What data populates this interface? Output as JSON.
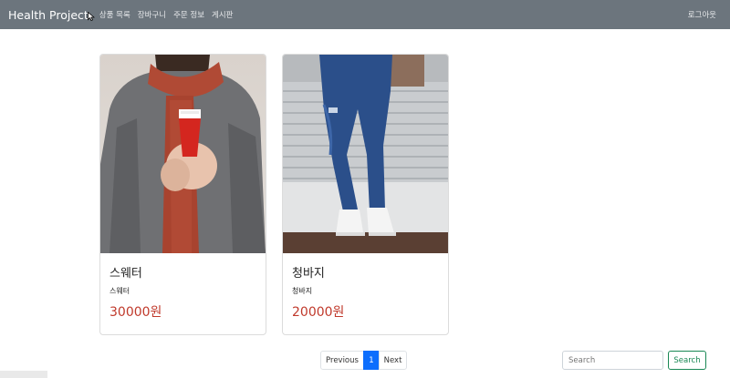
{
  "navbar": {
    "brand": "Health Project",
    "links": [
      "상품 목록",
      "장바구니",
      "주문 정보",
      "게시판"
    ],
    "logout": "로그아웃"
  },
  "products": [
    {
      "title": "스웨터",
      "desc": "스웨터",
      "price": "30000원",
      "image_icon": "sweater-photo"
    },
    {
      "title": "청바지",
      "desc": "청바지",
      "price": "20000원",
      "image_icon": "jeans-photo"
    }
  ],
  "pagination": {
    "prev": "Previous",
    "current": "1",
    "next": "Next"
  },
  "search": {
    "placeholder": "Search",
    "button": "Search"
  },
  "colors": {
    "navbar": "#6c757d",
    "price": "#c0392b",
    "active_page": "#0d6efd",
    "search_button": "#198754"
  }
}
